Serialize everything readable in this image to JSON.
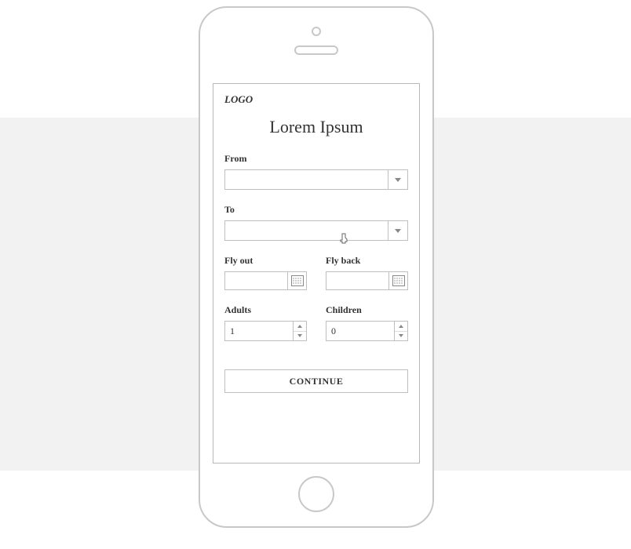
{
  "branding": {
    "logo": "LOGO"
  },
  "page": {
    "title": "Lorem Ipsum"
  },
  "labels": {
    "from": "From",
    "to": "To",
    "fly_out": "Fly out",
    "fly_back": "Fly back",
    "adults": "Adults",
    "children": "Children"
  },
  "values": {
    "from": "",
    "to": "",
    "fly_out": "",
    "fly_back": "",
    "adults": "1",
    "children": "0"
  },
  "actions": {
    "continue": "CONTINUE"
  }
}
